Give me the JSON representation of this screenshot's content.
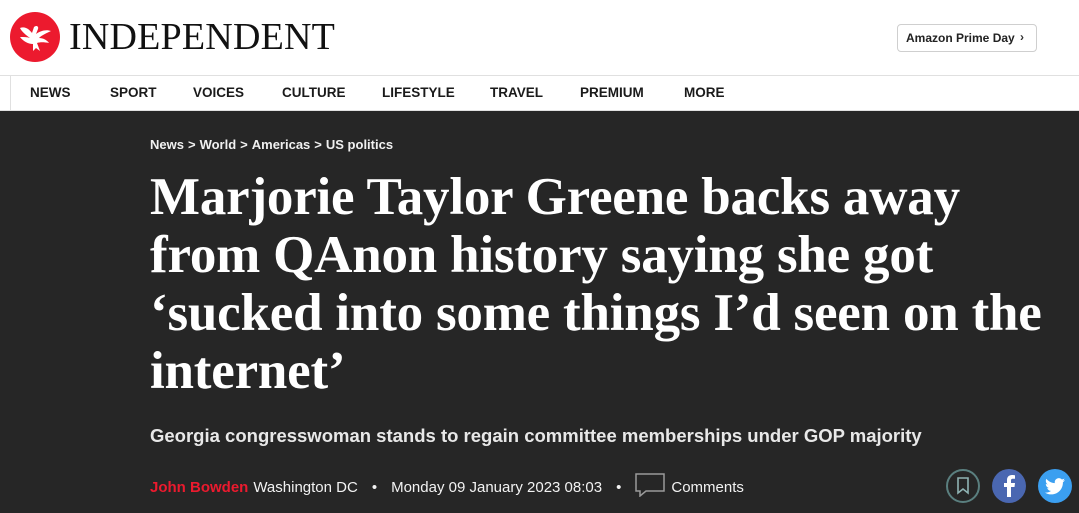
{
  "brand": {
    "name": "INDEPENDENT",
    "logo_icon": "eagle-icon",
    "brand_color": "#ec1a2e"
  },
  "promo": {
    "label": "Amazon Prime Day",
    "chevron": "›"
  },
  "nav": {
    "items": [
      {
        "label": "NEWS"
      },
      {
        "label": "SPORT"
      },
      {
        "label": "VOICES"
      },
      {
        "label": "CULTURE"
      },
      {
        "label": "LIFESTYLE"
      },
      {
        "label": "TRAVEL"
      },
      {
        "label": "PREMIUM"
      },
      {
        "label": "MORE"
      }
    ]
  },
  "breadcrumb": {
    "items": [
      {
        "label": "News"
      },
      {
        "label": "World"
      },
      {
        "label": "Americas"
      },
      {
        "label": "US politics"
      }
    ],
    "separator": ">"
  },
  "article": {
    "headline": "Marjorie Taylor Greene backs away from QAnon history saying she got ‘sucked into some things I’d seen on the internet’",
    "standfirst": "Georgia congresswoman stands to regain committee memberships under GOP majority",
    "author": "John Bowden",
    "location": "Washington DC",
    "date": "Monday 09 January 2023 08:03",
    "separator": "•",
    "comments_label": "Comments"
  },
  "share": {
    "icons": [
      "bookmark-icon",
      "facebook-icon",
      "twitter-icon"
    ],
    "colors": {
      "bookmark_ring": "#5a7f7f",
      "facebook": "#4a67b1",
      "twitter": "#3b9ff0"
    }
  },
  "colors": {
    "hero_background": "#262626",
    "accent": "#ec1a2e"
  }
}
